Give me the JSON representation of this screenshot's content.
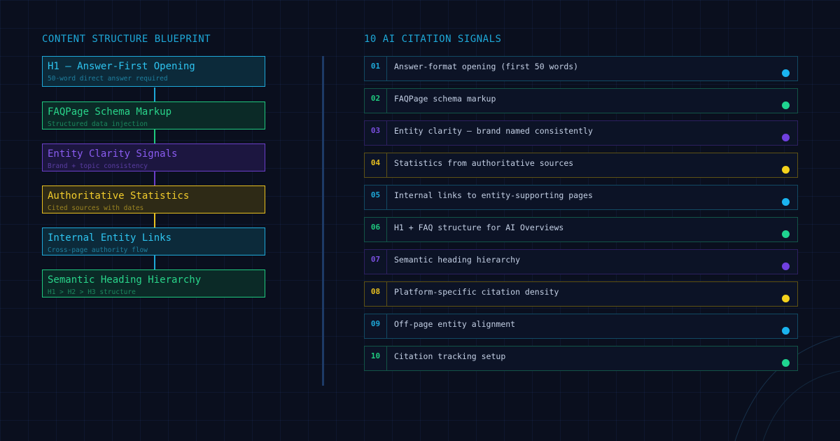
{
  "blueprint": {
    "heading": "CONTENT STRUCTURE BLUEPRINT",
    "blocks": [
      {
        "title": "H1 — Answer-First Opening",
        "subtitle": "50-word direct answer required",
        "color": "#1ea8d8"
      },
      {
        "title": "FAQPage Schema Markup",
        "subtitle": "Structured data injection",
        "color": "#1fc97f"
      },
      {
        "title": "Entity Clarity Signals",
        "subtitle": "Brand + topic consistency",
        "color": "#7a4fe0"
      },
      {
        "title": "Authoritative Statistics",
        "subtitle": "Cited sources with dates",
        "color": "#e8c020"
      },
      {
        "title": "Internal Entity Links",
        "subtitle": "Cross-page authority flow",
        "color": "#1ea8d8"
      },
      {
        "title": "Semantic Heading Hierarchy",
        "subtitle": "H1 > H2 > H3 structure",
        "color": "#1fc97f"
      }
    ]
  },
  "signals": {
    "heading": "10 AI CITATION SIGNALS",
    "items": [
      {
        "num": "01",
        "text": "Answer-format opening (first 50 words)",
        "color": "#1ea8d8"
      },
      {
        "num": "02",
        "text": "FAQPage schema markup",
        "color": "#1fc97f"
      },
      {
        "num": "03",
        "text": "Entity clarity — brand named consistently",
        "color": "#7a4fe0"
      },
      {
        "num": "04",
        "text": "Statistics from authoritative sources",
        "color": "#e8c020"
      },
      {
        "num": "05",
        "text": "Internal links to entity-supporting pages",
        "color": "#1ea8d8"
      },
      {
        "num": "06",
        "text": "H1 + FAQ structure for AI Overviews",
        "color": "#1fc97f"
      },
      {
        "num": "07",
        "text": "Semantic heading hierarchy",
        "color": "#7a4fe0"
      },
      {
        "num": "08",
        "text": "Platform-specific citation density",
        "color": "#e8c020"
      },
      {
        "num": "09",
        "text": "Off-page entity alignment",
        "color": "#1ea8d8"
      },
      {
        "num": "10",
        "text": "Citation tracking setup",
        "color": "#1fc97f"
      }
    ]
  }
}
